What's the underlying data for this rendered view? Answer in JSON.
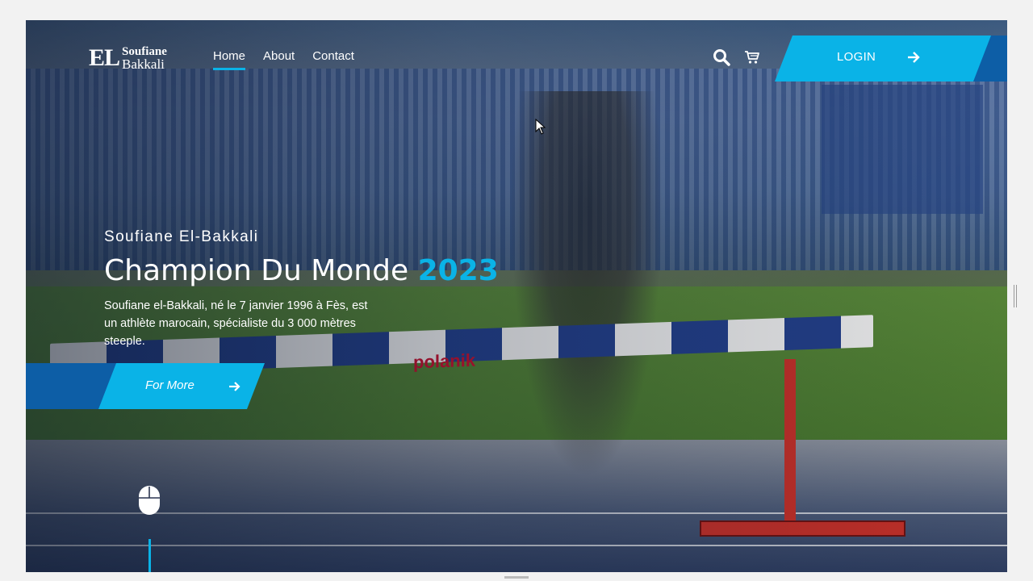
{
  "header": {
    "logo": {
      "initials": "EL",
      "first_name": "Soufiane",
      "last_name": "Bakkali"
    },
    "nav": [
      {
        "label": "Home",
        "active": true
      },
      {
        "label": "About",
        "active": false
      },
      {
        "label": "Contact",
        "active": false
      }
    ],
    "icons": [
      "search-icon",
      "cart-icon"
    ],
    "login_label": "LOGIN"
  },
  "hero": {
    "subtitle": "Soufiane El-Bakkali",
    "headline": "Champion Du Monde",
    "headline_year": "2023",
    "description": "Soufiane el-Bakkali, né le 7 janvier 1996 à Fès, est un athlète marocain, spécialiste du 3 000 mètres steeple.",
    "cta_label": "For More",
    "image_text": "polanik"
  },
  "colors": {
    "accent": "#0ab3e7",
    "accent_dark": "#0d5ea6",
    "text": "#ffffff"
  }
}
